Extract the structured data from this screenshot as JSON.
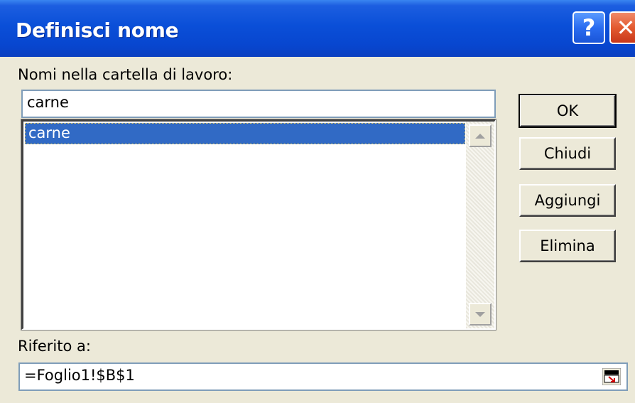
{
  "window": {
    "title": "Definisci nome"
  },
  "titlebar": {
    "help_glyph": "?",
    "close_glyph": "✕"
  },
  "names": {
    "label": "Nomi nella cartella di lavoro:",
    "input_value": "carne",
    "list_items": [
      "carne"
    ],
    "selected_index": 0
  },
  "buttons": {
    "ok": "OK",
    "close": "Chiudi",
    "add": "Aggiungi",
    "delete": "Elimina"
  },
  "reference": {
    "label": "Riferito a:",
    "value": "=Foglio1!$B$1"
  },
  "colors": {
    "titlebar": "#0a4fd8",
    "selection": "#316ac5",
    "dialog_bg": "#ece9d8",
    "close_button": "#e35a30"
  },
  "icons": {
    "help": "help-icon",
    "close": "close-icon",
    "refedit": "collapse-dialog-icon"
  }
}
